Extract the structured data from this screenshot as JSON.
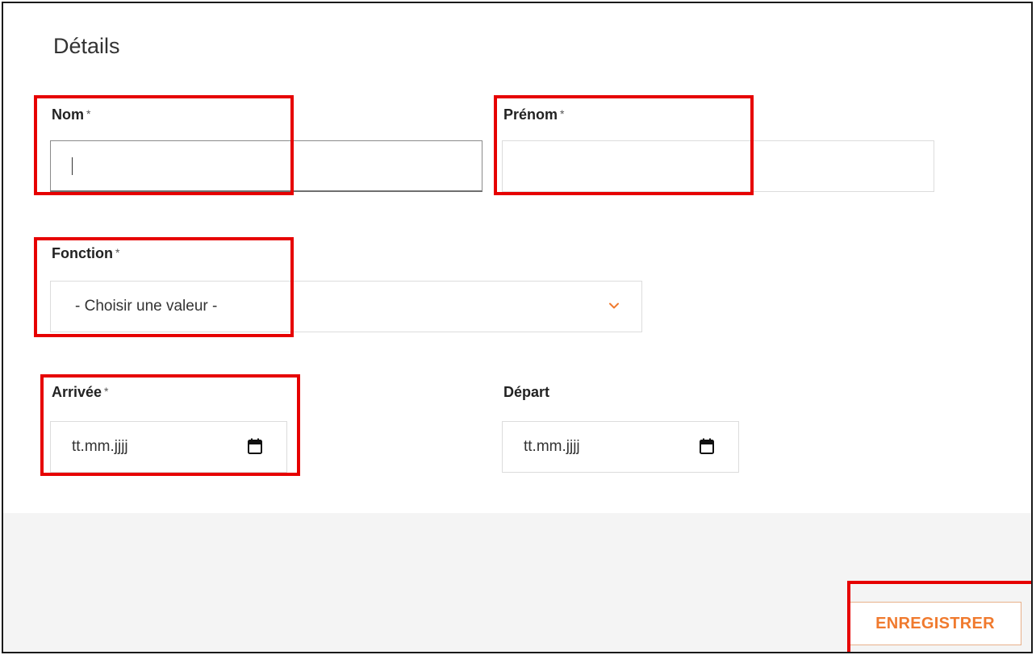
{
  "section": {
    "title": "Détails"
  },
  "form": {
    "required_mark": "*",
    "nom": {
      "label": "Nom",
      "value": ""
    },
    "prenom": {
      "label": "Prénom",
      "value": ""
    },
    "fonction": {
      "label": "Fonction",
      "selected": "- Choisir une valeur -"
    },
    "arrivee": {
      "label": "Arrivée",
      "placeholder": "tt.mm.jjjj"
    },
    "depart": {
      "label": "Départ",
      "placeholder": "tt.mm.jjjj"
    }
  },
  "footer": {
    "save_label": "ENREGISTRER"
  },
  "icons": {
    "dropdown": "chevron-down-icon",
    "calendar": "calendar-icon"
  },
  "colors": {
    "accent": "#f07a2e",
    "highlight": "#e60000",
    "footer_bg": "#f4f4f4"
  }
}
